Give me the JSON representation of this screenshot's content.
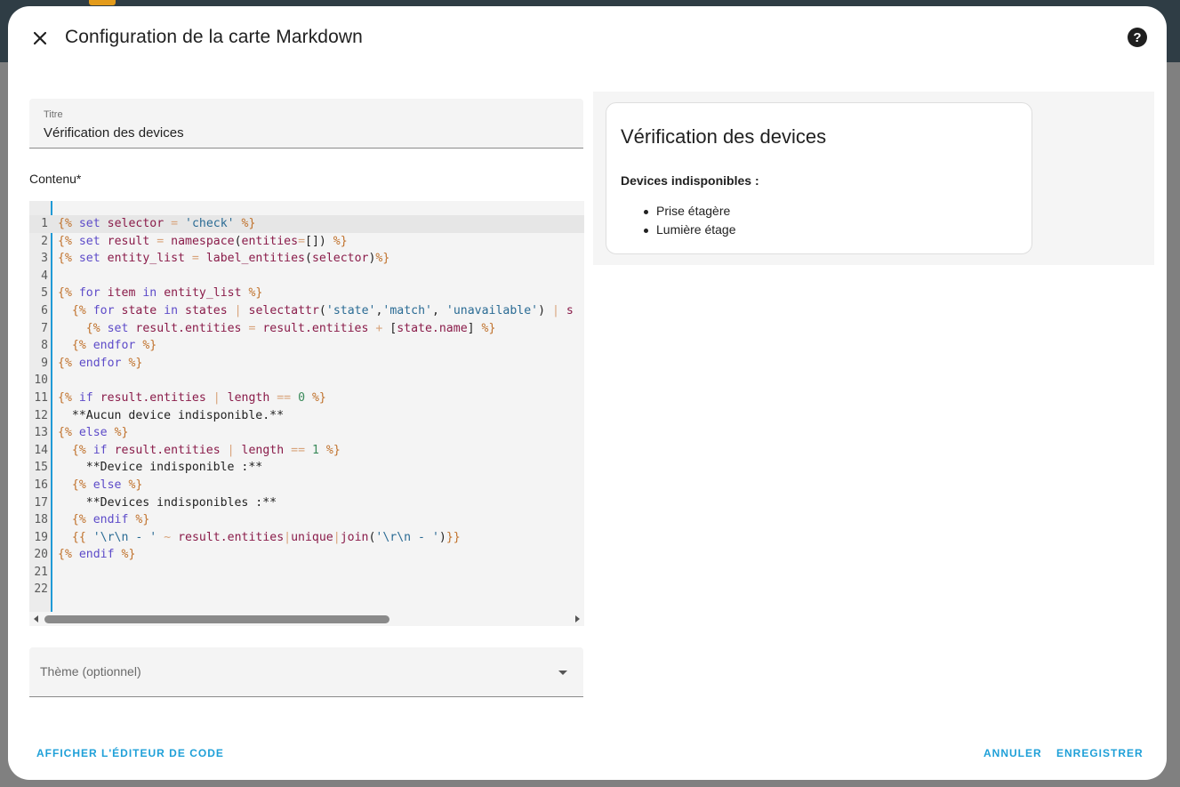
{
  "dialog": {
    "title": "Configuration de la carte Markdown",
    "close_icon": "close-icon",
    "help_icon": "help-icon",
    "help_glyph": "?"
  },
  "editor": {
    "title_label": "Titre",
    "title_value": "Vérification des devices",
    "content_label": "Contenu*",
    "theme_placeholder": "Thème (optionnel)"
  },
  "code_lines": [
    {
      "n": "1",
      "html": "<span class='d'>{%</span> <span class='k'>set</span> <span class='v'>selector</span> <span class='o'>=</span> <span class='s'>'check'</span> <span class='d'>%}</span>"
    },
    {
      "n": "2",
      "html": "<span class='d'>{%</span> <span class='k'>set</span> <span class='v'>result</span> <span class='o'>=</span> <span class='v'>namespace</span>(<span class='v'>entities</span><span class='o'>=</span>[]) <span class='d'>%}</span>"
    },
    {
      "n": "3",
      "html": "<span class='d'>{%</span> <span class='k'>set</span> <span class='v'>entity_list</span> <span class='o'>=</span> <span class='v'>label_entities</span>(<span class='v'>selector</span>)<span class='d'>%}</span>"
    },
    {
      "n": "4",
      "html": ""
    },
    {
      "n": "5",
      "html": "<span class='d'>{%</span> <span class='k'>for</span> <span class='v'>item</span> <span class='k'>in</span> <span class='v'>entity_list</span> <span class='d'>%}</span>"
    },
    {
      "n": "6",
      "html": "  <span class='d'>{%</span> <span class='k'>for</span> <span class='v'>state</span> <span class='k'>in</span> <span class='v'>states</span> <span class='o'>|</span> <span class='v'>selectattr</span>(<span class='s'>'state'</span>,<span class='s'>'match'</span>, <span class='s'>'unavailable'</span>) <span class='o'>|</span> <span class='v'>s</span>"
    },
    {
      "n": "7",
      "html": "    <span class='d'>{%</span> <span class='k'>set</span> <span class='v'>result.entities</span> <span class='o'>=</span> <span class='v'>result.entities</span> <span class='o'>+</span> [<span class='v'>state.name</span>] <span class='d'>%}</span>"
    },
    {
      "n": "8",
      "html": "  <span class='d'>{%</span> <span class='k'>endfor</span> <span class='d'>%}</span>"
    },
    {
      "n": "9",
      "html": "<span class='d'>{%</span> <span class='k'>endfor</span> <span class='d'>%}</span>"
    },
    {
      "n": "10",
      "html": ""
    },
    {
      "n": "11",
      "html": "<span class='d'>{%</span> <span class='k'>if</span> <span class='v'>result.entities</span> <span class='o'>|</span> <span class='v'>length</span> <span class='o'>==</span> <span class='n'>0</span> <span class='d'>%}</span>"
    },
    {
      "n": "12",
      "html": "  **Aucun device indisponible.**"
    },
    {
      "n": "13",
      "html": "<span class='d'>{%</span> <span class='k'>else</span> <span class='d'>%}</span>"
    },
    {
      "n": "14",
      "html": "  <span class='d'>{%</span> <span class='k'>if</span> <span class='v'>result.entities</span> <span class='o'>|</span> <span class='v'>length</span> <span class='o'>==</span> <span class='n'>1</span> <span class='d'>%}</span>"
    },
    {
      "n": "15",
      "html": "    **Device indisponible :**"
    },
    {
      "n": "16",
      "html": "  <span class='d'>{%</span> <span class='k'>else</span> <span class='d'>%}</span>"
    },
    {
      "n": "17",
      "html": "    **Devices indisponibles :**"
    },
    {
      "n": "18",
      "html": "  <span class='d'>{%</span> <span class='k'>endif</span> <span class='d'>%}</span>"
    },
    {
      "n": "19",
      "html": "  <span class='d'>{{</span> <span class='s'>'\\r\\n - '</span> <span class='o'>~</span> <span class='v'>result.entities</span><span class='o'>|</span><span class='v'>unique</span><span class='o'>|</span><span class='v'>join</span>(<span class='s'>'\\r\\n - '</span>)<span class='d'>}}</span>"
    },
    {
      "n": "20",
      "html": "<span class='d'>{%</span> <span class='k'>endif</span> <span class='d'>%}</span>"
    },
    {
      "n": "21",
      "html": ""
    },
    {
      "n": "22",
      "html": ""
    }
  ],
  "preview": {
    "title": "Vérification des devices",
    "heading": "Devices indisponibles :",
    "items": [
      "Prise étagère",
      "Lumière étage"
    ]
  },
  "footer": {
    "show_code_label": "AFFICHER L'ÉDITEUR DE CODE",
    "cancel_label": "ANNULER",
    "save_label": "ENREGISTRER"
  },
  "colors": {
    "accent": "#1fa0d8",
    "header_bar": "#2f3d45"
  }
}
